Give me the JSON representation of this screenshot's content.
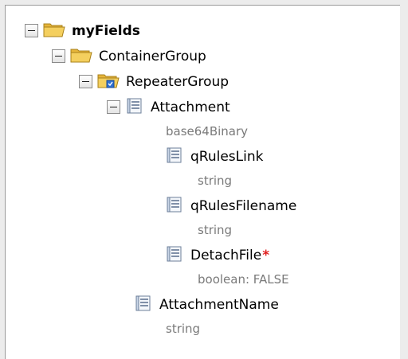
{
  "tree": {
    "root": {
      "label": "myFields"
    },
    "container_group": {
      "label": "ContainerGroup"
    },
    "repeater_group": {
      "label": "RepeaterGroup"
    },
    "attachment": {
      "label": "Attachment",
      "type": "base64Binary"
    },
    "qrules_link": {
      "label": "qRulesLink",
      "type": "string"
    },
    "qrules_filename": {
      "label": "qRulesFilename",
      "type": "string"
    },
    "detach_file": {
      "label": "DetachFile",
      "required_marker": "*",
      "type": "boolean: FALSE"
    },
    "attachment_name": {
      "label": "AttachmentName",
      "type": "string"
    }
  },
  "icons": {
    "folder": "folder-icon",
    "repeating_folder": "repeating-folder-icon",
    "field": "field-icon"
  },
  "colors": {
    "required_marker": "#e02020",
    "type_text": "#7a7a7a",
    "folder": "#f2c94c"
  }
}
